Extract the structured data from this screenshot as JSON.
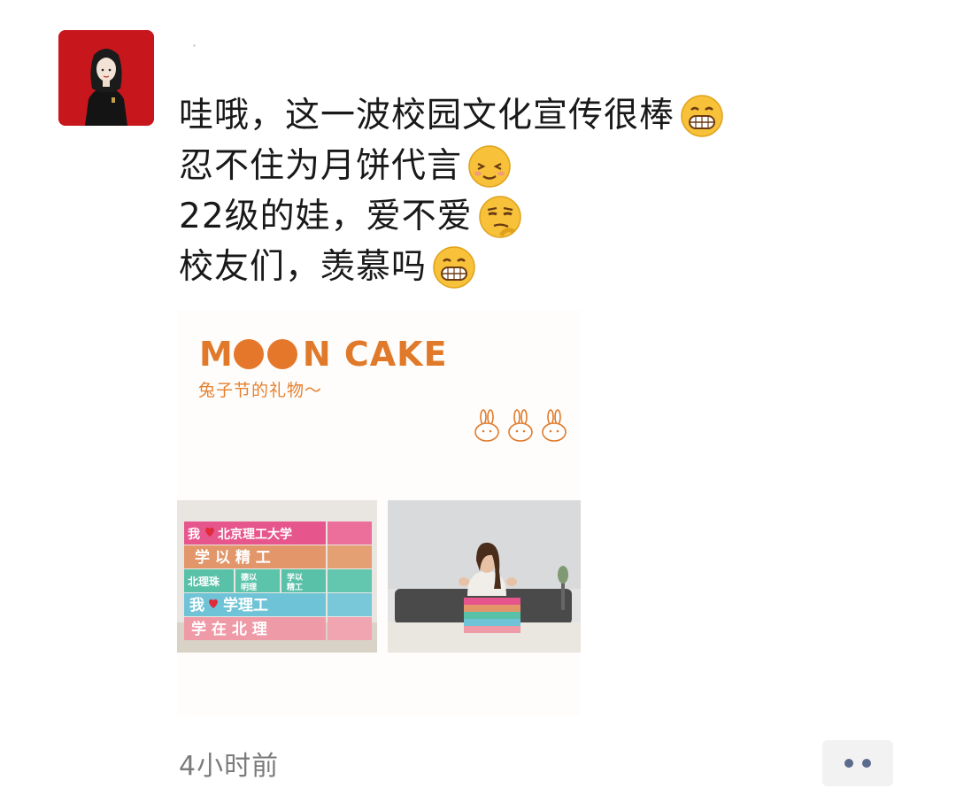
{
  "post": {
    "lines": [
      {
        "text": "哇哦，这一波校园文化宣传很棒",
        "emoji": "grinning-face-icon"
      },
      {
        "text": "忍不住为月饼代言",
        "emoji": "relieved-face-icon"
      },
      {
        "text": "22级的娃，爱不爱",
        "emoji": "smirk-face-icon"
      },
      {
        "text": "校友们，羡慕吗",
        "emoji": "grinning-face-icon"
      }
    ],
    "timestamp": "4小时前"
  },
  "card": {
    "title_suffix": "N CAKE",
    "title_prefix": "M",
    "subtitle": "兔子节的礼物～",
    "accent": "#e07a2a",
    "box_rows": [
      [
        "我❤北京理工大学",
        ""
      ],
      [
        "学 以 精 工",
        ""
      ],
      [
        "北理珠",
        "德以明理",
        "学以精工",
        ""
      ],
      [
        "我❤学理工",
        ""
      ],
      [
        "学 在 北 理",
        ""
      ]
    ]
  },
  "colors": {
    "avatar_bg": "#c8161d",
    "text": "#191919",
    "timestamp": "#7b7b7b",
    "more_dots": "#5b6b8c"
  }
}
